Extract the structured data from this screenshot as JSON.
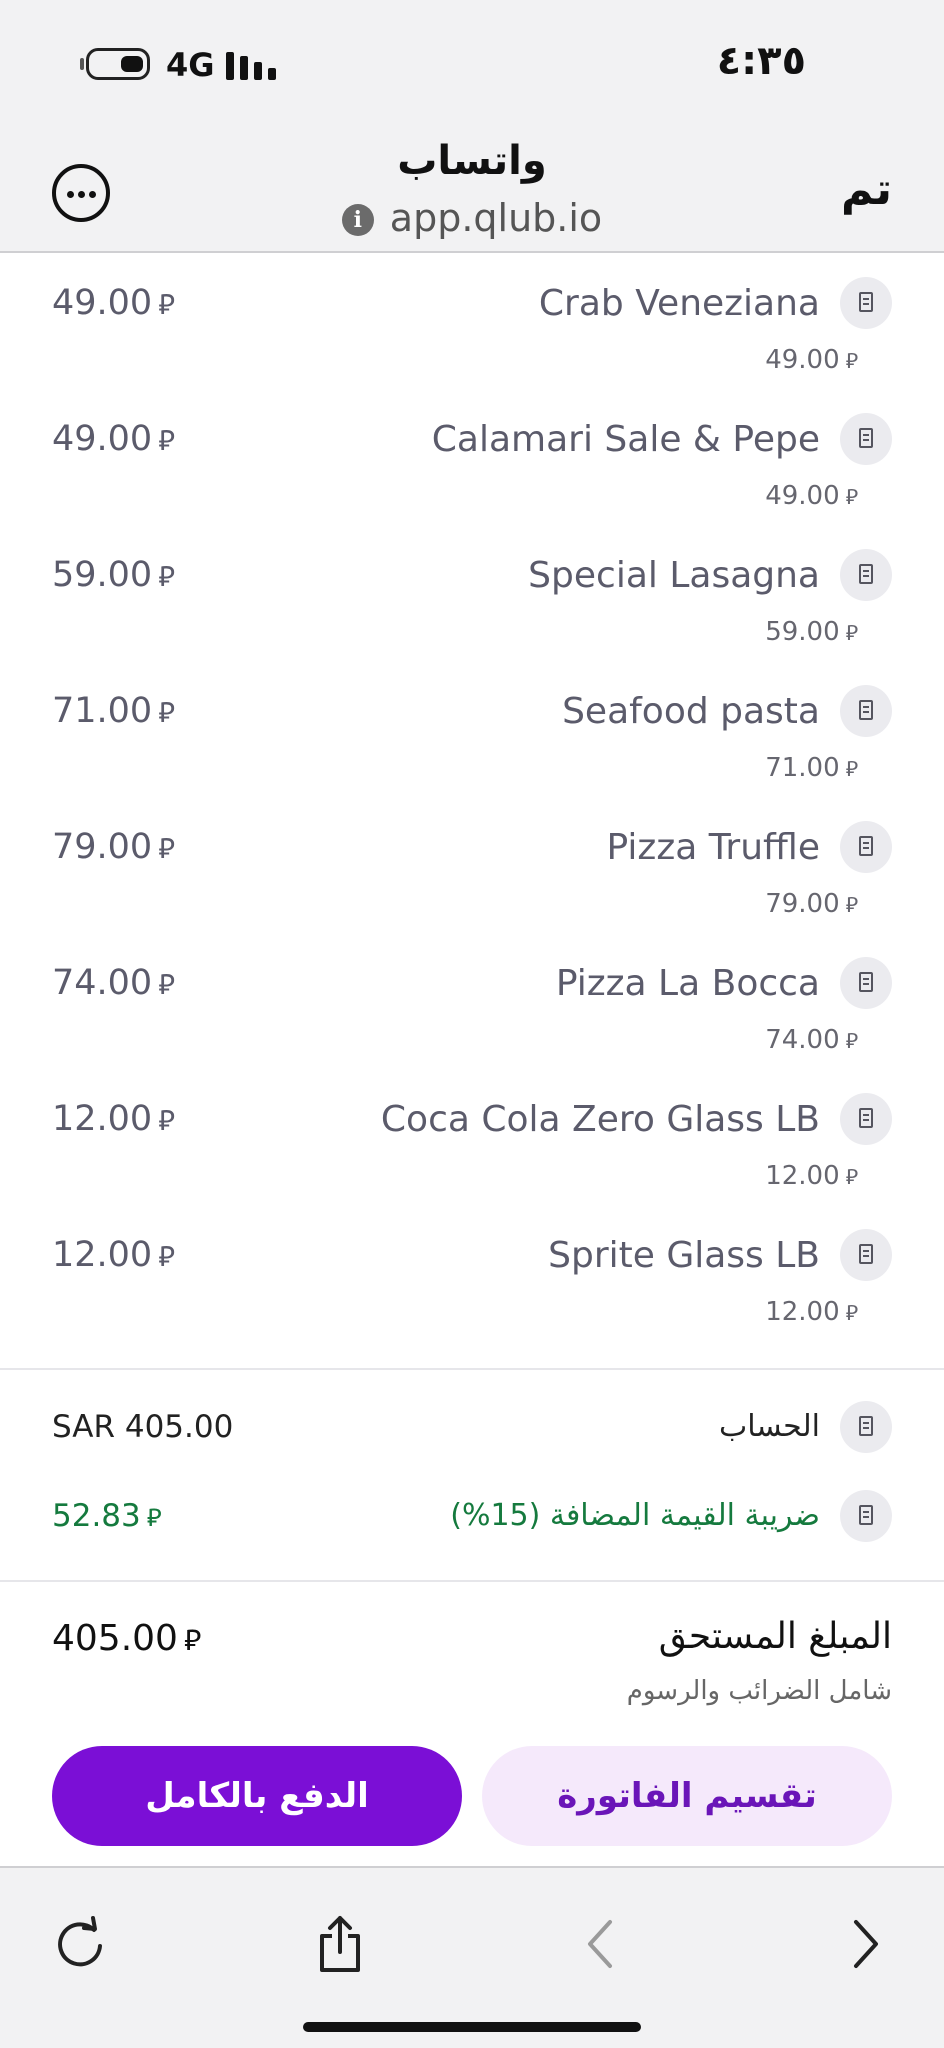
{
  "status": {
    "time": "٤:٣٥",
    "network": "4G"
  },
  "browser": {
    "title": "واتساب",
    "url": "app.qlub.io",
    "done_label": "تم"
  },
  "currency_symbol": "⃁",
  "items": [
    {
      "name": "Crab Veneziana",
      "unit_price": "49.00",
      "total": "49.00"
    },
    {
      "name": "Calamari Sale & Pepe",
      "unit_price": "49.00",
      "total": "49.00"
    },
    {
      "name": "Special Lasagna",
      "unit_price": "59.00",
      "total": "59.00"
    },
    {
      "name": "Seafood pasta",
      "unit_price": "71.00",
      "total": "71.00"
    },
    {
      "name": "Pizza Truffle",
      "unit_price": "79.00",
      "total": "79.00"
    },
    {
      "name": "Pizza La Bocca",
      "unit_price": "74.00",
      "total": "74.00"
    },
    {
      "name": "Coca Cola Zero Glass LB",
      "unit_price": "12.00",
      "total": "12.00"
    },
    {
      "name": "Sprite Glass LB",
      "unit_price": "12.00",
      "total": "12.00"
    }
  ],
  "summary": {
    "bill_label": "الحساب",
    "bill_value": "SAR 405.00",
    "vat_label": "ضريبة القيمة المضافة (15%)",
    "vat_value": "52.83"
  },
  "amount_due": {
    "label": "المبلغ المستحق",
    "sublabel": "شامل الضرائب والرسوم",
    "value": "405.00"
  },
  "actions": {
    "pay_full": "الدفع بالكامل",
    "split_bill": "تقسيم الفاتورة"
  },
  "colors": {
    "primary": "#7b0fd6",
    "primary_light": "#f5e9fb",
    "vat_green": "#157a3e"
  }
}
